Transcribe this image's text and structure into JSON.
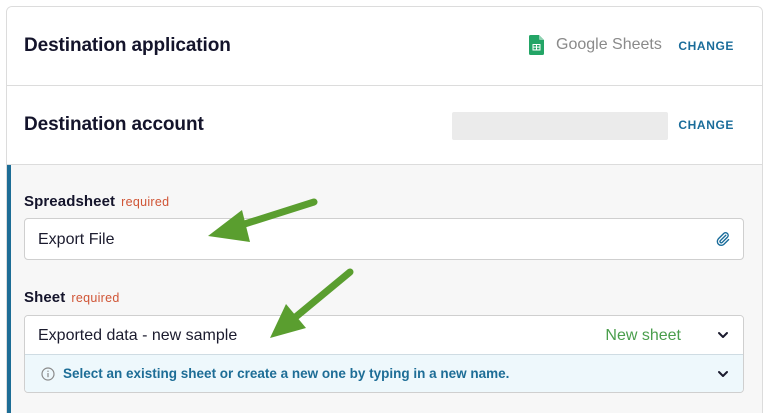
{
  "destination_application": {
    "title": "Destination application",
    "app_name": "Google Sheets",
    "app_icon": "google-sheets-icon",
    "change_label": "CHANGE"
  },
  "destination_account": {
    "title": "Destination account",
    "change_label": "CHANGE"
  },
  "spreadsheet": {
    "label": "Spreadsheet",
    "required_label": "required",
    "value": "Export File",
    "icon": "paperclip-icon"
  },
  "sheet": {
    "label": "Sheet",
    "required_label": "required",
    "value": "Exported data - new sample",
    "new_sheet_label": "New sheet",
    "hint": "Select an existing sheet or create a new one by typing in a new name.",
    "hint_icon": "info-icon"
  },
  "colors": {
    "accent": "#1a6c9a",
    "required": "#d05536",
    "new_sheet": "#4a9e4c",
    "arrow": "#5a9e2f",
    "hint_bg": "#eef8fc"
  }
}
